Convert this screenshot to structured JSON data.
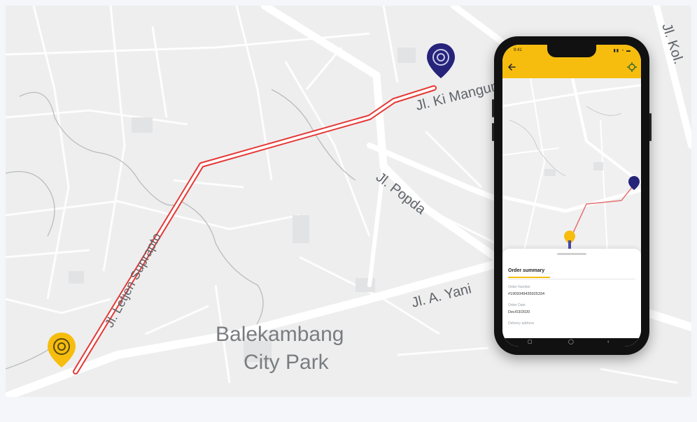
{
  "map": {
    "streets": {
      "ki_mangun": "Jl. Ki Mangunsarkoro",
      "kol": "Jl. Kol.",
      "popda": "Jl. Popda",
      "a_yani": "Jl. A. Yani",
      "letjen": "Jl. Letjen Suprapto"
    },
    "park": {
      "line1": "Balekambang",
      "line2": "City Park"
    },
    "route_color": "#e53935",
    "origin_marker": {
      "icon": "location-pin-icon",
      "color": "#f6bd0f"
    },
    "destination_marker": {
      "icon": "location-pin-icon",
      "color": "#26237a"
    }
  },
  "phone": {
    "status_time": "9:41",
    "status_icons": "▮▮ ◔ ▬",
    "header_color": "#f6bd0f",
    "back_icon": "arrow-left-icon",
    "locate_icon": "crosshair-icon",
    "sheet": {
      "title": "Order summary",
      "fields": [
        {
          "label": "Order Number",
          "value": "#1909349435925334"
        },
        {
          "label": "Order Date",
          "value": "Dec/03/2020"
        },
        {
          "label": "Delivery address",
          "value": ""
        }
      ]
    },
    "nav": {
      "square": "▢",
      "circle": "◯",
      "back": "‹"
    }
  }
}
